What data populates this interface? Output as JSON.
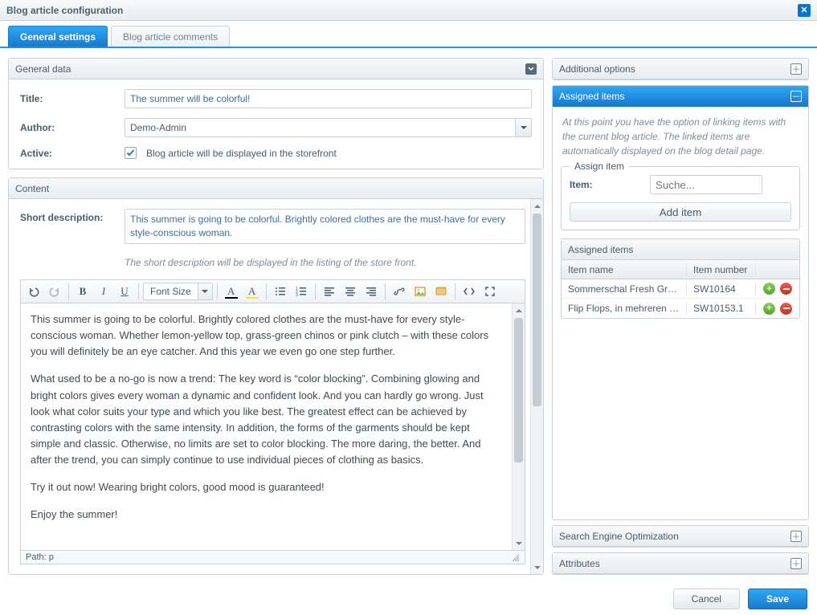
{
  "window": {
    "title": "Blog article configuration"
  },
  "tabs": {
    "general": "General settings",
    "comments": "Blog article comments"
  },
  "general_data": {
    "panel_title": "General data",
    "title_label": "Title:",
    "title_value": "The summer will be colorful!",
    "author_label": "Author:",
    "author_value": "Demo-Admin",
    "active_label": "Active:",
    "active_checked": true,
    "active_text": "Blog article will be displayed in the storefront"
  },
  "content": {
    "panel_title": "Content",
    "short_desc_label": "Short description:",
    "short_desc_value": "This summer is going to be colorful. Brightly colored clothes are the must-have for every style-conscious woman.",
    "short_desc_hint": "The short description will be displayed in the listing of the store front.",
    "font_size_label": "Font Size",
    "editor_paragraphs": [
      "This summer is going to be colorful. Brightly colored clothes are the must-have for every style-conscious woman. Whether lemon-yellow top, grass-green chinos or pink clutch – with these colors you will definitely be an eye catcher. And this year we even go one step further.",
      "What used to be a no-go is now a trend: The key word is “color blocking”. Combining glowing and bright colors gives every woman a dynamic and confident look. And you can hardly go wrong. Just look what color suits your type and which you like best. The greatest effect can be achieved by contrasting colors with the same intensity. In addition, the forms of the garments should be kept simple and classic. Otherwise, no limits are set to color blocking. The more daring, the better. And after the trend, you can simply continue to use individual pieces of clothing as basics.",
      "Try it out now! Wearing bright colors, good mood is guaranteed!",
      "Enjoy the summer!"
    ],
    "path_label": "Path: p"
  },
  "side": {
    "additional_title": "Additional options",
    "assigned_panel_title": "Assigned items",
    "hint": "At this point you have the option of linking items with the current blog article. The linked items are automatically displayed on the blog detail page.",
    "fieldset_legend": "Assign item",
    "item_label": "Item:",
    "item_placeholder": "Suche...",
    "add_button": "Add item",
    "grid_title": "Assigned items",
    "grid_headers": {
      "name": "Item name",
      "number": "Item number"
    },
    "grid_rows": [
      {
        "name": "Sommerschal Fresh Green",
        "number": "SW10164"
      },
      {
        "name": "Flip Flops, in mehreren Farben...",
        "number": "SW10153.1"
      }
    ],
    "seo_title": "Search Engine Optimization",
    "attributes_title": "Attributes"
  },
  "footer": {
    "cancel": "Cancel",
    "save": "Save"
  }
}
